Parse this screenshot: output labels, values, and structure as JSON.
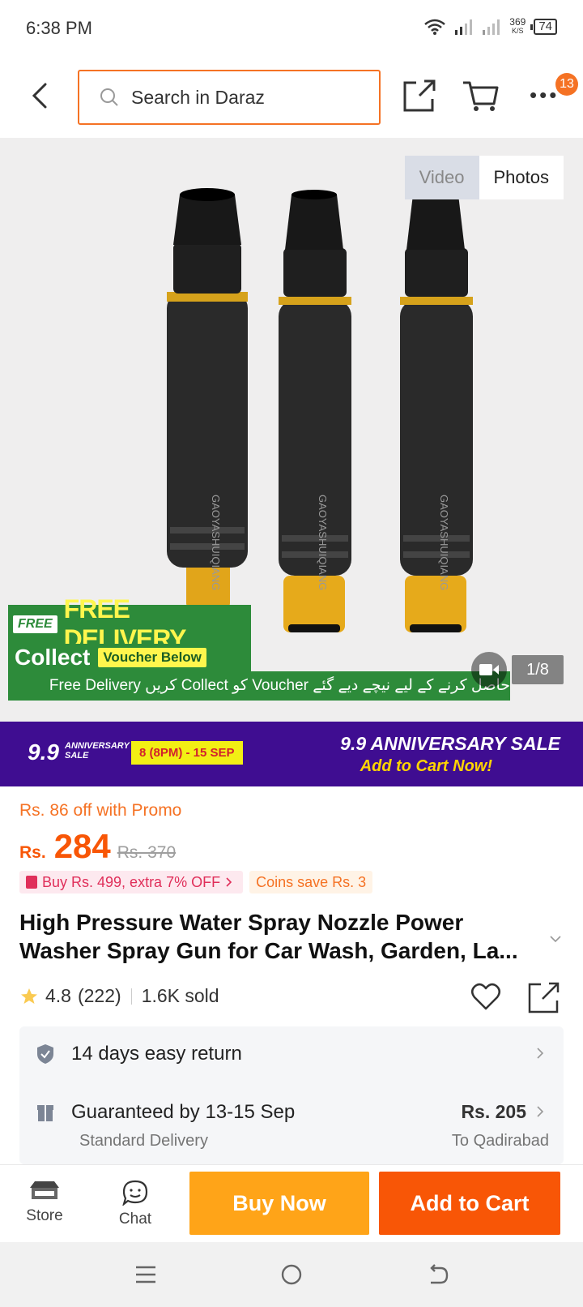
{
  "status_bar": {
    "time": "6:38 PM",
    "speed_value": "369",
    "speed_unit": "K/S",
    "battery": "74"
  },
  "search": {
    "placeholder": "Search in Daraz"
  },
  "header": {
    "notification_count": "13"
  },
  "gallery": {
    "tab_video": "Video",
    "tab_photos": "Photos",
    "counter": "1/8",
    "product_brand_print": "GAOYASHUIQIANG",
    "banner": {
      "tag": "FREE",
      "headline": "FREE DELIVERY",
      "collect": "Collect",
      "voucher": "Voucher Below",
      "urdu_line": "حاصل کرنے کے لیے نیچے دیے گئے Voucher کو Collect کریں Free Delivery"
    }
  },
  "sale_banner": {
    "logo_number": "9.9",
    "logo_text_line1": "ANNIVERSARY",
    "logo_text_line2": "SALE",
    "date": "8 (8PM) - 15 SEP",
    "headline": "9.9 ANNIVERSARY SALE",
    "cta": "Add to Cart Now!",
    "colors": {
      "background": "#3f0d91",
      "accent": "#ffd400"
    }
  },
  "pricing": {
    "promo": "Rs. 86 off with Promo",
    "currency": "Rs.",
    "price": "284",
    "original_price": "Rs. 370",
    "tag_bundle": "Buy Rs. 499, extra 7% OFF",
    "tag_coins": "Coins save Rs. 3",
    "accent_color": "#f85606"
  },
  "product": {
    "title": "High Pressure Water Spray Nozzle Power Washer Spray Gun for Car Wash, Garden, La...",
    "rating": "4.8",
    "reviews": "(222)",
    "sold": "1.6K sold"
  },
  "services": {
    "return_policy": "14 days easy return",
    "delivery_guarantee": "Guaranteed by 13-15 Sep",
    "delivery_type": "Standard Delivery",
    "delivery_price": "Rs. 205",
    "delivery_to": "To Qadirabad"
  },
  "action_bar": {
    "store_label": "Store",
    "chat_label": "Chat",
    "buy_now": "Buy Now",
    "add_to_cart": "Add to Cart",
    "colors": {
      "buy_now": "#ffa418",
      "add_to_cart": "#f85606"
    }
  }
}
